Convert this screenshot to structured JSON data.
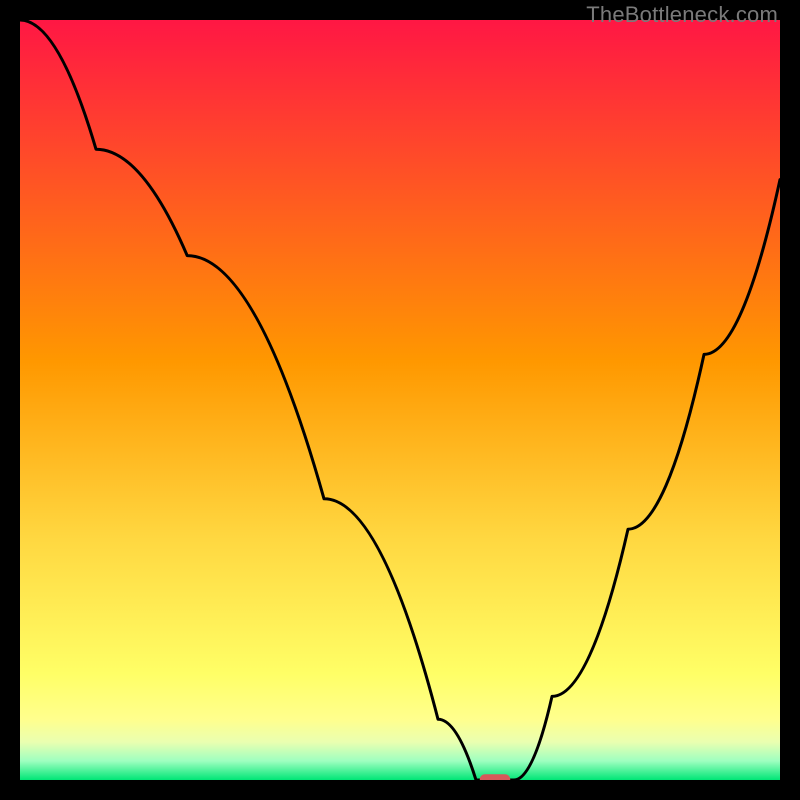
{
  "watermark": "TheBottleneck.com",
  "chart_data": {
    "type": "line",
    "title": "",
    "xlabel": "",
    "ylabel": "",
    "xlim": [
      0,
      100
    ],
    "ylim": [
      0,
      100
    ],
    "grid": false,
    "series": [
      {
        "name": "bottleneck-curve",
        "x": [
          0,
          10,
          22,
          40,
          55,
          60,
          62,
          65,
          70,
          80,
          90,
          100
        ],
        "values": [
          100,
          83,
          69,
          37,
          8,
          0,
          0,
          0,
          11,
          33,
          56,
          79
        ]
      }
    ],
    "marker": {
      "name": "optimal-point",
      "x": 62.5,
      "y": 0,
      "color": "#d85a5a",
      "width": 4,
      "height": 1.5
    },
    "background": {
      "top_color": "#ff1744",
      "mid_color": "#ffd740",
      "accent_band_color": "#ffff8d",
      "bottom_color": "#00e676"
    },
    "axis_color": "#000000",
    "line_color": "#000000",
    "line_width": 3
  }
}
